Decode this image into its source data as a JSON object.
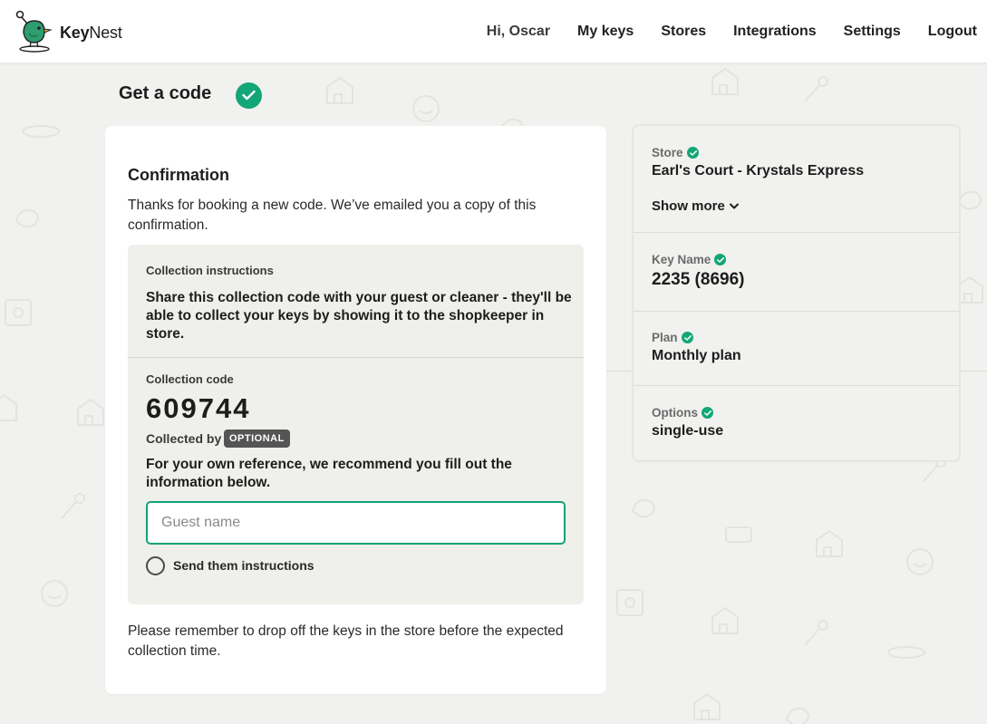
{
  "header": {
    "brand_bold": "Key",
    "brand_light": "Nest",
    "logo_icon": "bird-key-logo",
    "nav": {
      "greeting": "Hi, Oscar",
      "my_keys": "My keys",
      "stores": "Stores",
      "integrations": "Integrations",
      "settings": "Settings",
      "logout": "Logout"
    }
  },
  "page": {
    "title": "Get a code",
    "title_icon": "check-circle-icon"
  },
  "confirmation": {
    "heading": "Confirmation",
    "intro": "Thanks for booking a new code. We’ve emailed you a copy of this confirmation.",
    "collection_instructions_label": "Collection instructions",
    "collection_instructions_text": "Share this collection code with your guest or cleaner - they'll be able to collect your keys by showing it to the shopkeeper in store.",
    "collection_code_label": "Collection code",
    "collection_code": "609744",
    "collected_by_label": "Collected by",
    "optional_badge": "OPTIONAL",
    "reference_text": "For your own reference, we recommend you fill out the information below.",
    "guest_name": {
      "value": "",
      "placeholder": "Guest name"
    },
    "send_instructions_label": "Send them instructions",
    "send_instructions_checked": false,
    "footer_note": "Please remember to drop off the keys in the store before the expected collection time."
  },
  "summary": {
    "store_label": "Store",
    "store_value": "Earl's Court - Krystals Express",
    "show_more": "Show more",
    "key_name_label": "Key Name",
    "key_name_value": "2235 (8696)",
    "plan_label": "Plan",
    "plan_value": "Monthly plan",
    "options_label": "Options",
    "options_value": "single-use"
  },
  "colors": {
    "accent": "#13a677",
    "input_border": "#14a276",
    "background": "#f1f1ef",
    "card": "#ffffff",
    "inner_panel": "#efefeb",
    "badge": "#555555"
  }
}
